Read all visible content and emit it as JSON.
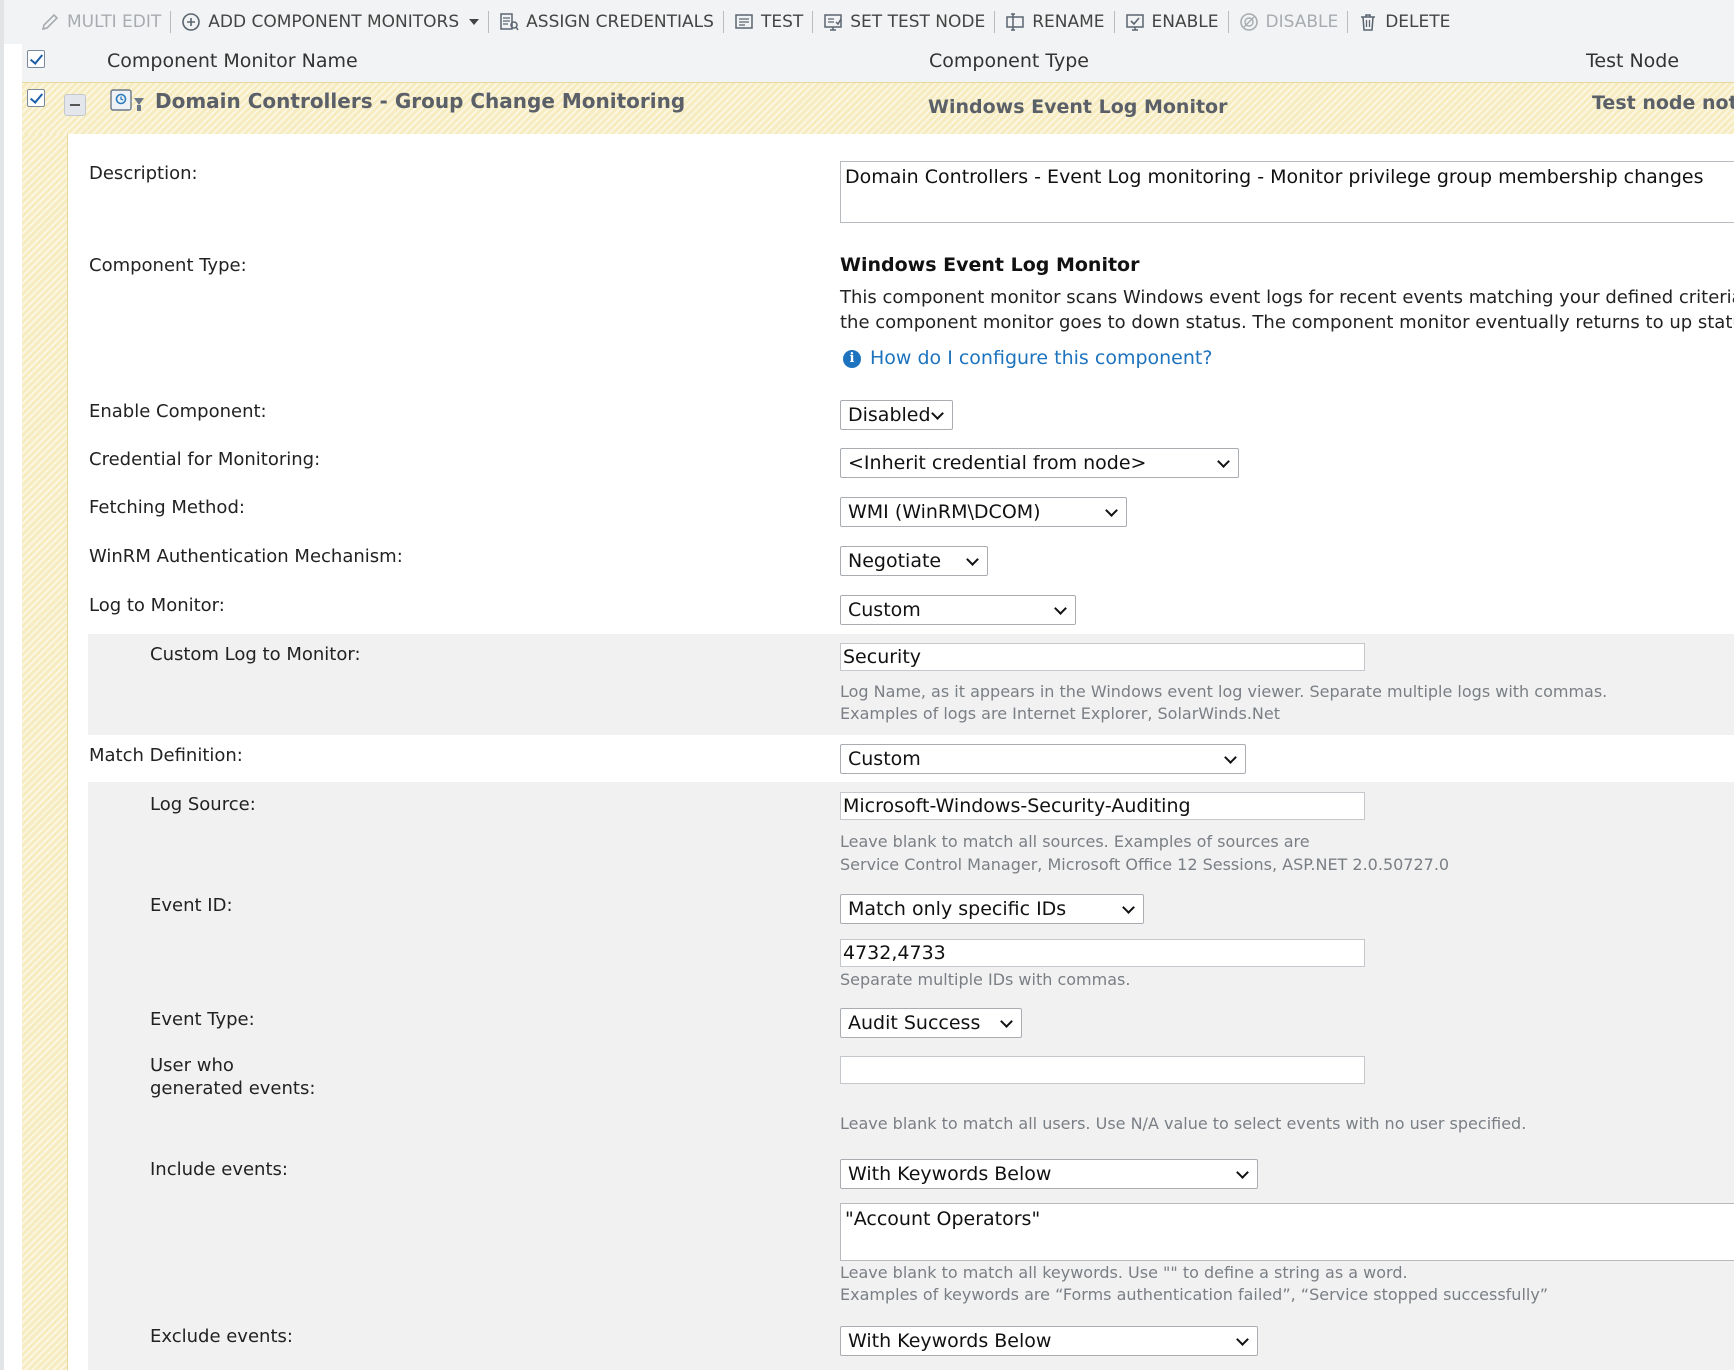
{
  "toolbar": {
    "multi_edit": "MULTI EDIT",
    "add_component_monitors": "ADD COMPONENT MONITORS",
    "assign_credentials": "ASSIGN CREDENTIALS",
    "test": "TEST",
    "set_test_node": "SET TEST NODE",
    "rename": "RENAME",
    "enable": "ENABLE",
    "disable": "DISABLE",
    "delete": "DELETE"
  },
  "table": {
    "col_name": "Component Monitor Name",
    "col_type": "Component Type",
    "col_test_node": "Test Node"
  },
  "component": {
    "name": "Domain Controllers - Group Change Monitoring",
    "type": "Windows Event Log Monitor",
    "test_node": "Test node not s"
  },
  "form": {
    "description_label": "Description:",
    "description_value": "Domain Controllers - Event Log monitoring - Monitor privilege group membership changes",
    "component_type_label": "Component Type:",
    "component_type_title": "Windows Event Log Monitor",
    "component_type_desc_1": "This component monitor scans Windows event logs for recent events matching your defined criteria. Ev",
    "component_type_desc_2": "the component monitor goes to down status. The component monitor eventually returns to up status a",
    "help_link": "How do I configure this component?",
    "enable_label": "Enable Component:",
    "enable_value": "Disabled",
    "credential_label": "Credential for Monitoring:",
    "credential_value": "<Inherit credential from node>",
    "fetching_label": "Fetching Method:",
    "fetching_value": "WMI (WinRM\\DCOM)",
    "winrm_label": "WinRM Authentication Mechanism:",
    "winrm_value": "Negotiate",
    "log_label": "Log to Monitor:",
    "log_value": "Custom",
    "custom_log_label": "Custom Log to Monitor:",
    "custom_log_value": "Security",
    "custom_log_hint_1": "Log Name, as it appears in the Windows event log viewer. Separate multiple logs with commas.",
    "custom_log_hint_2": "Examples of logs are Internet Explorer, SolarWinds.Net",
    "match_label": "Match Definition:",
    "match_value": "Custom",
    "log_source_label": "Log Source:",
    "log_source_value": "Microsoft-Windows-Security-Auditing",
    "log_source_hint_1": "Leave blank to match all sources. Examples of sources are",
    "log_source_hint_2": "Service Control Manager, Microsoft Office 12 Sessions, ASP.NET 2.0.50727.0",
    "event_id_label": "Event ID:",
    "event_id_mode": "Match only specific IDs",
    "event_id_value": "4732,4733",
    "event_id_hint": "Separate multiple IDs with commas.",
    "event_type_label": "Event Type:",
    "event_type_value": "Audit Success",
    "user_label_1": "User who",
    "user_label_2": "generated events:",
    "user_value": "",
    "user_hint": "Leave blank to match all users. Use N/A value to select events with no user specified.",
    "include_label": "Include events:",
    "include_mode": "With Keywords Below",
    "include_value": "\"Account Operators\"",
    "include_hint_1": "Leave blank to match all keywords. Use \"\" to define a string as a word.",
    "include_hint_2": "Examples of keywords are “Forms authentication failed”, “Service stopped successfully”",
    "exclude_label": "Exclude events:",
    "exclude_mode": "With Keywords Below"
  },
  "colors": {
    "row_highlight": "#f6ecc0",
    "link": "#1e73be",
    "toolbar_bg": "#f2f3f4"
  }
}
